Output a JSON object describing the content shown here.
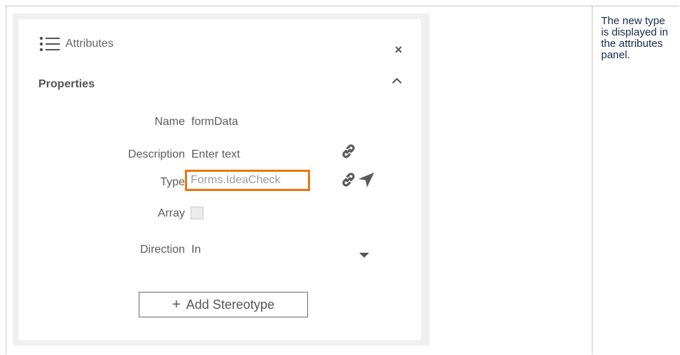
{
  "panel": {
    "title": "Attributes",
    "close_glyph": "×",
    "section_title": "Properties",
    "icons": {
      "header": "list-icon",
      "collapse": "chevron-up-icon",
      "link": "link-icon",
      "navigate": "navigation-arrow-icon",
      "dropdown": "caret-down-icon"
    },
    "fields": {
      "name_label": "Name",
      "name_value": "formData",
      "description_label": "Description",
      "description_placeholder": "Enter text",
      "type_label": "Type",
      "type_value": "Forms.IdeaCheck",
      "array_label": "Array",
      "array_checked": false,
      "direction_label": "Direction",
      "direction_value": "In"
    },
    "add_stereotype_plus": "+",
    "add_stereotype_label": "Add Stereotype",
    "highlight_color": "#e8780f"
  },
  "note": {
    "text": "The new type is displayed in the attributes panel."
  }
}
